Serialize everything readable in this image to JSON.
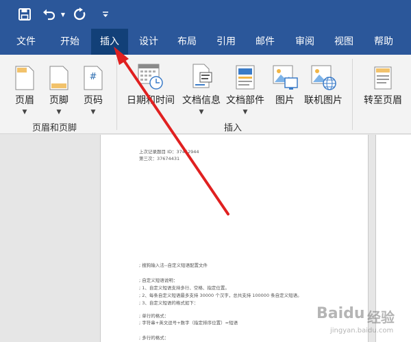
{
  "quick_access": {
    "save_icon": "save-icon",
    "undo_icon": "undo-icon",
    "redo_icon": "repeat-icon",
    "customize_icon": "customize-toolbar-icon"
  },
  "tabs": [
    {
      "label": "文件"
    },
    {
      "label": "开始"
    },
    {
      "label": "插入",
      "active": true
    },
    {
      "label": "设计"
    },
    {
      "label": "布局"
    },
    {
      "label": "引用"
    },
    {
      "label": "邮件"
    },
    {
      "label": "审阅"
    },
    {
      "label": "视图"
    },
    {
      "label": "帮助"
    }
  ],
  "ribbon": {
    "groups": [
      {
        "label": "页眉和页脚",
        "buttons": [
          {
            "label": "页眉",
            "icon": "header-icon"
          },
          {
            "label": "页脚",
            "icon": "footer-icon"
          },
          {
            "label": "页码",
            "icon": "page-number-icon"
          }
        ]
      },
      {
        "label": "插入",
        "buttons": [
          {
            "label": "日期和时间",
            "icon": "date-time-icon"
          },
          {
            "label": "文档信息",
            "icon": "document-info-icon"
          },
          {
            "label": "文档部件",
            "icon": "document-parts-icon"
          },
          {
            "label": "图片",
            "icon": "picture-icon"
          },
          {
            "label": "联机图片",
            "icon": "online-picture-icon"
          }
        ]
      },
      {
        "label": "",
        "buttons": [
          {
            "label": "转至页眉",
            "icon": "go-to-header-icon"
          }
        ]
      }
    ]
  },
  "document": {
    "lines": [
      "上次记录题目 ID：37452944",
      "第三次：37674431",
      ";  搜狗输入法--自定义短语配置文件",
      ";  自定义短语说明：",
      ";  1、自定义短语支持多行、空格、指定位置。",
      ";  2、每条自定义短语最多支持 30000 个汉字，总共支持 100000 条自定义短语。",
      ";  3、自定义短语的格式如下：",
      ";  单行的格式：",
      ";  字符串+英文逗号+数字（指定排序位置）=短语",
      ";  多行的格式："
    ]
  },
  "watermark": {
    "brand": "Baidu",
    "suffix": "经验",
    "url": "jingyan.baidu.com"
  },
  "colors": {
    "accent": "#2b579a",
    "active_tab": "#124078",
    "arrow": "#e02020"
  }
}
